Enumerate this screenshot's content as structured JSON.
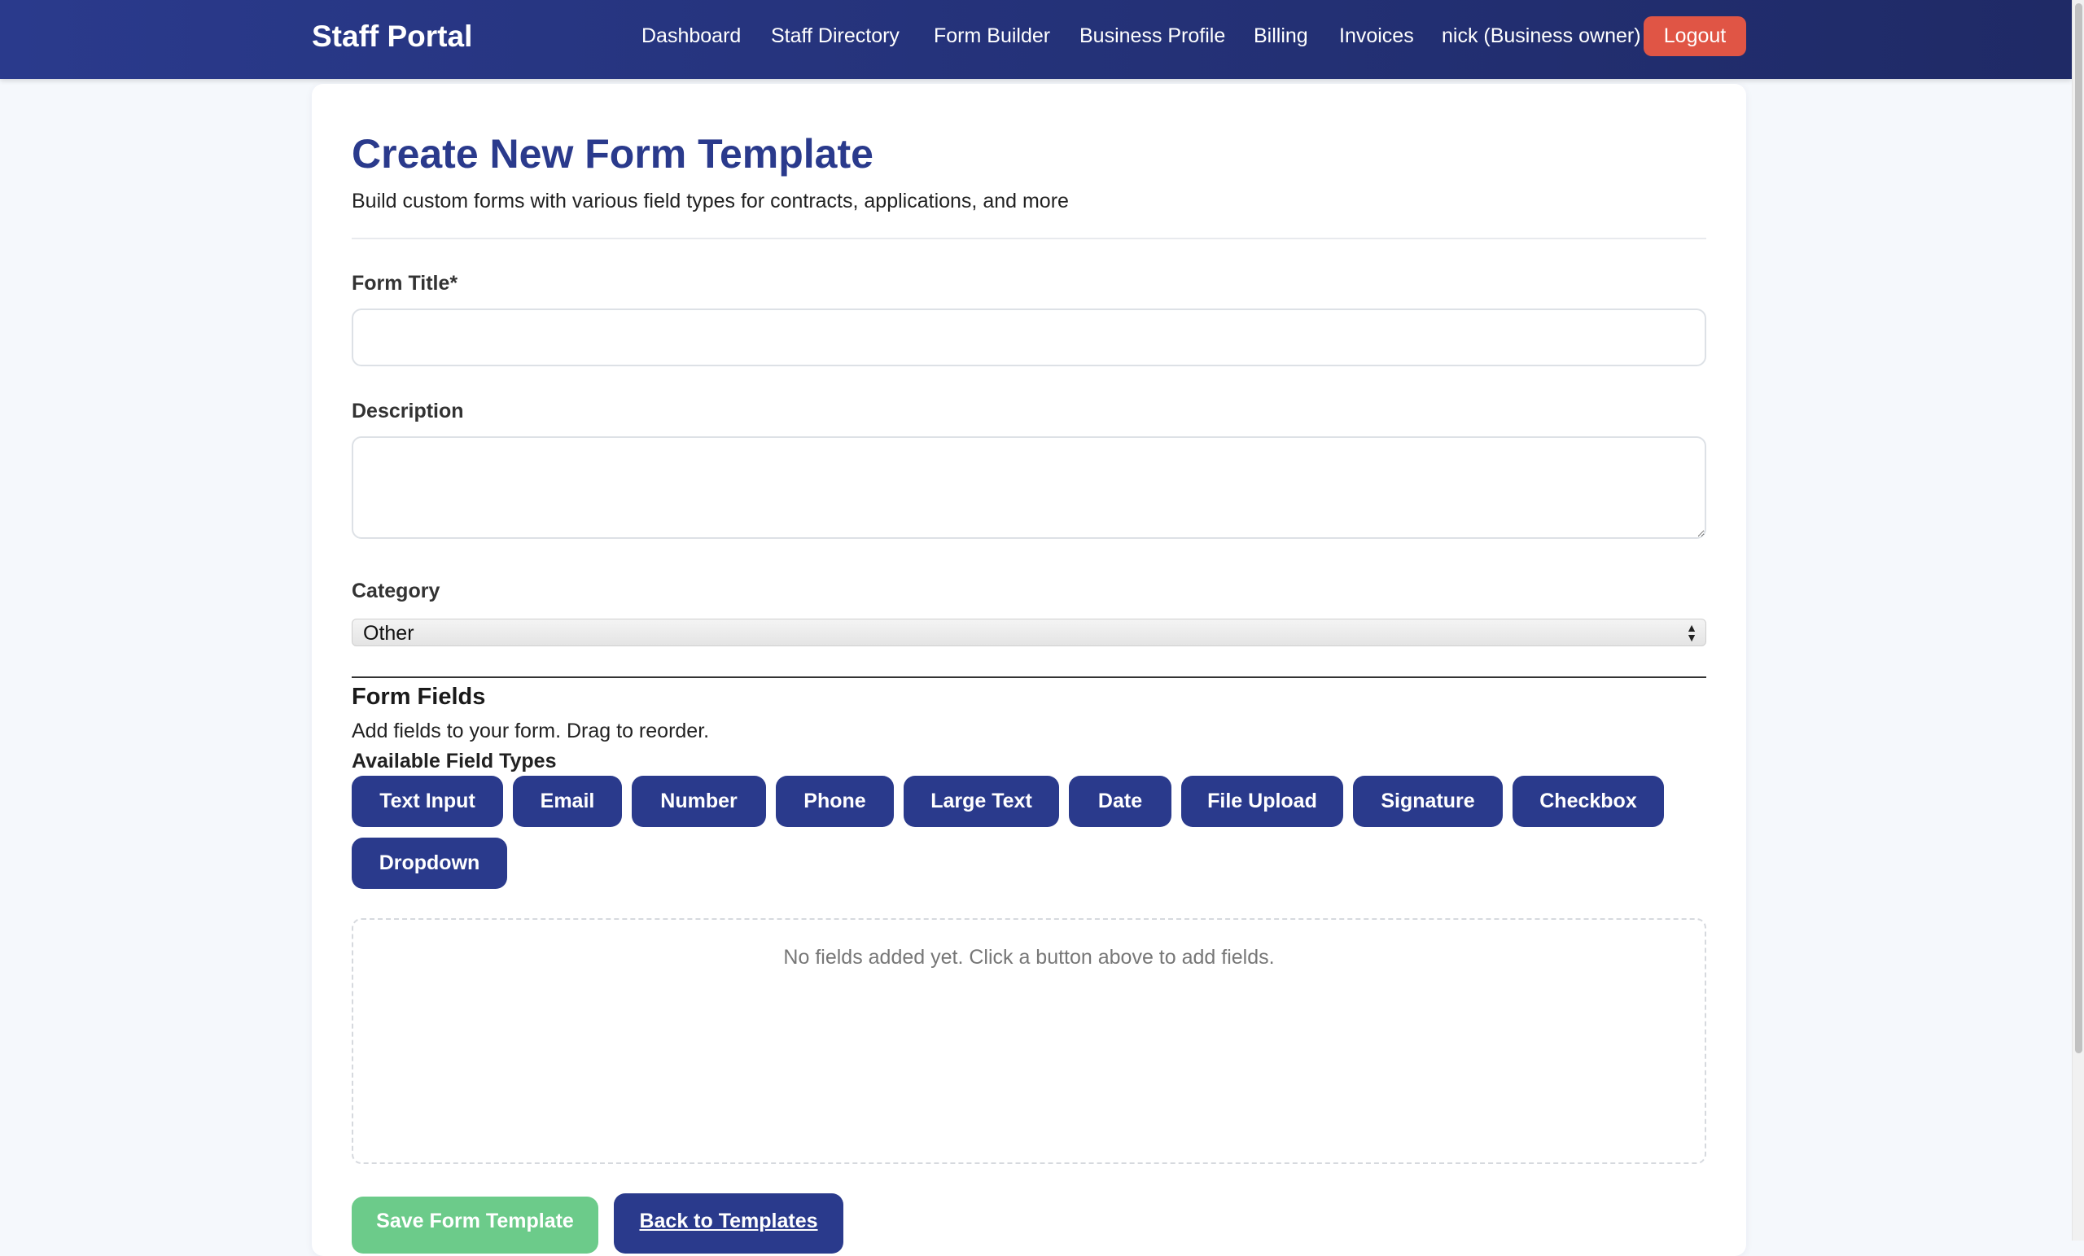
{
  "navbar": {
    "brand": "Staff Portal",
    "links": [
      {
        "label": "Dashboard"
      },
      {
        "label": "Staff Directory"
      },
      {
        "label": "Form Builder"
      },
      {
        "label": "Business Profile"
      },
      {
        "label": "Billing"
      },
      {
        "label": "Invoices"
      }
    ],
    "user": "nick (Business owner)",
    "logout_label": "Logout",
    "colors": {
      "background": "#2a3a8c",
      "logout": "#e05545"
    }
  },
  "page": {
    "title": "Create New Form Template",
    "subtitle": "Build custom forms with various field types for contracts, applications, and more"
  },
  "form": {
    "title_label": "Form Title*",
    "title_value": "",
    "description_label": "Description",
    "description_value": "",
    "category_label": "Category",
    "category_selected": "Other"
  },
  "fields_section": {
    "title": "Form Fields",
    "description": "Add fields to your form. Drag to reorder.",
    "available_label": "Available Field Types",
    "field_types": [
      {
        "label": "Text Input"
      },
      {
        "label": "Email"
      },
      {
        "label": "Number"
      },
      {
        "label": "Phone"
      },
      {
        "label": "Large Text"
      },
      {
        "label": "Date"
      },
      {
        "label": "File Upload"
      },
      {
        "label": "Signature"
      },
      {
        "label": "Checkbox"
      },
      {
        "label": "Dropdown"
      }
    ],
    "empty_message": "No fields added yet. Click a button above to add fields.",
    "button_color": "#2a3a8c"
  },
  "actions": {
    "save_label": "Save Form Template",
    "back_label": "Back to Templates",
    "save_color": "#6ccb8a"
  }
}
